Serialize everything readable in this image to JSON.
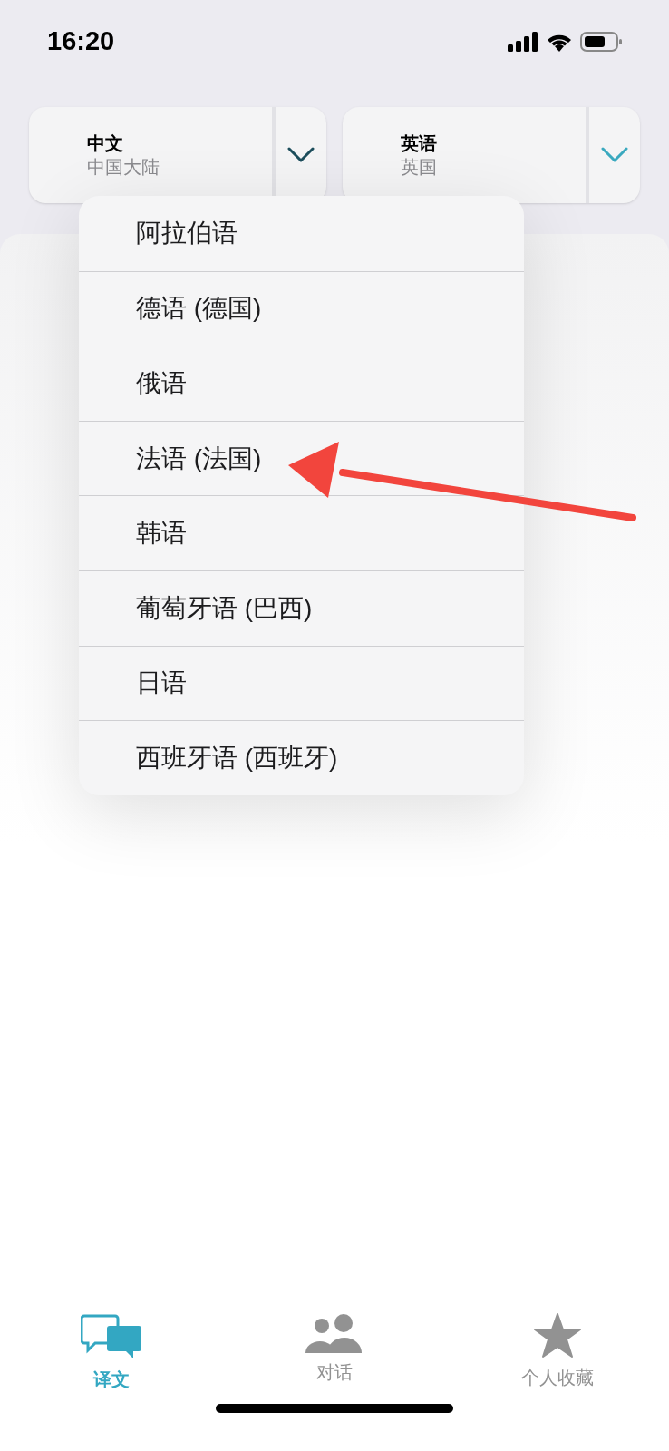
{
  "status_bar": {
    "time": "16:20"
  },
  "language_selectors": [
    {
      "language": "中文",
      "region": "中国大陆",
      "expanded": true
    },
    {
      "language": "英语",
      "region": "英国",
      "expanded": false
    }
  ],
  "language_menu": {
    "items": [
      {
        "label": "阿拉伯语"
      },
      {
        "label": "德语 (德国)"
      },
      {
        "label": "俄语"
      },
      {
        "label": "法语 (法国)"
      },
      {
        "label": "韩语"
      },
      {
        "label": "葡萄牙语 (巴西)"
      },
      {
        "label": "日语"
      },
      {
        "label": "西班牙语 (西班牙)"
      }
    ]
  },
  "tab_bar": [
    {
      "kind": "translate",
      "label": "译文",
      "selected": true
    },
    {
      "kind": "conversation",
      "label": "对话",
      "selected": false
    },
    {
      "kind": "favorites",
      "label": "个人收藏",
      "selected": false
    }
  ]
}
